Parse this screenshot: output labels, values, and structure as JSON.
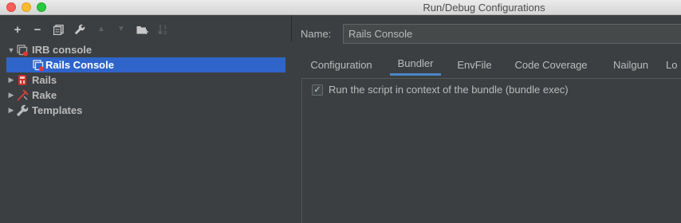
{
  "window": {
    "title": "Run/Debug Configurations"
  },
  "toolbar": {
    "buttons": [
      {
        "name": "add",
        "glyph": "+"
      },
      {
        "name": "remove",
        "glyph": "−"
      },
      {
        "name": "copy",
        "glyph": "⧉"
      },
      {
        "name": "edit-defaults",
        "glyph": "🔧"
      },
      {
        "name": "move-up",
        "glyph": "▲"
      },
      {
        "name": "move-down",
        "glyph": "▼"
      },
      {
        "name": "new-folder",
        "glyph": "▬"
      },
      {
        "name": "sort",
        "glyph": "↓"
      }
    ]
  },
  "tree": {
    "items": [
      {
        "label": "IRB console",
        "expanded": true,
        "icon": "irb-console-icon"
      },
      {
        "label": "Rails Console",
        "selected": true,
        "icon": "irb-console-icon"
      },
      {
        "label": "Rails",
        "expanded": false,
        "icon": "rails-icon"
      },
      {
        "label": "Rake",
        "expanded": false,
        "icon": "rake-icon"
      },
      {
        "label": "Templates",
        "expanded": false,
        "icon": "wrench-icon"
      }
    ]
  },
  "form": {
    "name_label": "Name:",
    "name_value": "Rails Console"
  },
  "tabs": [
    {
      "label": "Configuration"
    },
    {
      "label": "Bundler",
      "active": true
    },
    {
      "label": "EnvFile"
    },
    {
      "label": "Code Coverage"
    },
    {
      "label": "Nailgun"
    },
    {
      "label": "Lo"
    }
  ],
  "bundler": {
    "checkbox_label": "Run the script in context of the bundle (bundle exec)",
    "checked": true
  },
  "colors": {
    "selection": "#2f65ca",
    "accent": "#4a88c7",
    "background": "#3c3f41"
  }
}
